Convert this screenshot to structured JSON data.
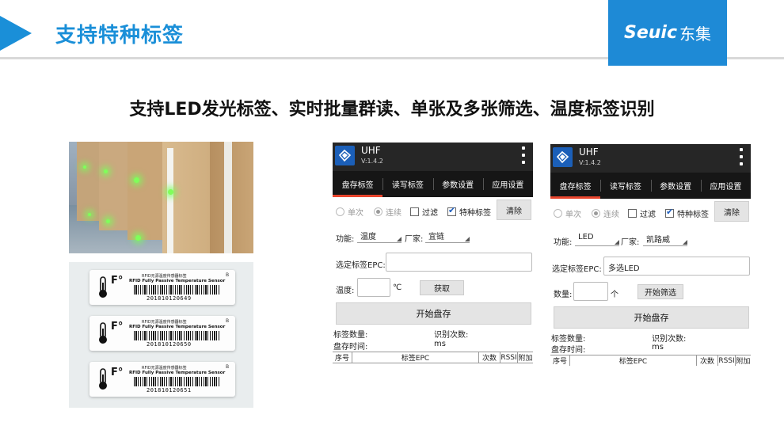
{
  "slide": {
    "title": "支持特种标签",
    "subtitle": "支持LED发光标签、实时批量群读、单张及多张筛选、温度标签识别",
    "logo_latin": "Seuic",
    "logo_cn": "东集",
    "accent_color": "#1a8fd8"
  },
  "tags": [
    {
      "line1": "RFID无源温度传感器标签",
      "line2": "RFID Fully Passive Temperature Sensor",
      "corner": "B",
      "serial": "201810120649"
    },
    {
      "line1": "RFID无源温度传感器标签",
      "line2": "RFID Fully Passive Temperature Sensor",
      "corner": "B",
      "serial": "201810120650"
    },
    {
      "line1": "RFID无源温度传感器标签",
      "line2": "RFID Fully Passive Temperature Sensor",
      "corner": "B",
      "serial": "201810120651"
    }
  ],
  "apps": [
    {
      "app_name": "UHF",
      "version": "V:1.4.2",
      "tabs": [
        "盘存标签",
        "读写标签",
        "参数设置",
        "应用设置"
      ],
      "active_tab": 0,
      "mode_single": "单次",
      "mode_continuous": "连续",
      "filter_label": "过滤",
      "special_label": "特种标签",
      "clear_button": "清除",
      "function_label": "功能:",
      "function_value": "温度",
      "vendor_label": "厂家:",
      "vendor_value": "宜链",
      "epc_label": "选定标签EPC:",
      "epc_value": "",
      "extra_label": "温度:",
      "extra_value": "",
      "extra_unit": "℃",
      "extra_button": "获取",
      "start_button": "开始盘存",
      "tag_count_label": "标签数量:",
      "read_count_label": "识别次数:",
      "inventory_time_label": "盘存时间:",
      "time_unit": "ms",
      "columns": [
        "序号",
        "标签EPC",
        "次数",
        "RSSI",
        "附加"
      ]
    },
    {
      "app_name": "UHF",
      "version": "V:1.4.2",
      "tabs": [
        "盘存标签",
        "读写标签",
        "参数设置",
        "应用设置"
      ],
      "active_tab": 0,
      "mode_single": "单次",
      "mode_continuous": "连续",
      "filter_label": "过滤",
      "special_label": "特种标签",
      "clear_button": "清除",
      "function_label": "功能:",
      "function_value": "LED",
      "vendor_label": "厂家:",
      "vendor_value": "凯路威",
      "epc_label": "选定标签EPC:",
      "epc_value": "多选LED",
      "extra_label": "数量:",
      "extra_value": "",
      "extra_unit": "个",
      "extra_button": "开始筛选",
      "start_button": "开始盘存",
      "tag_count_label": "标签数量:",
      "read_count_label": "识别次数:",
      "inventory_time_label": "盘存时间:",
      "time_unit": "ms",
      "columns": [
        "序号",
        "标签EPC",
        "次数",
        "RSSI",
        "附加"
      ]
    }
  ]
}
